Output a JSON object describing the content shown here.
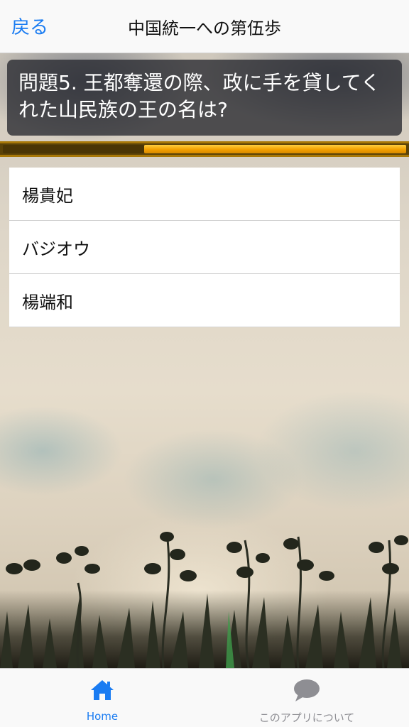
{
  "nav": {
    "back_label": "戻る",
    "title": "中国統一への第伍歩"
  },
  "question": {
    "text": "問題5. 王都奪還の際、政に手を貸してくれた山民族の王の名は?"
  },
  "progress": {
    "fraction": 0.35
  },
  "answers": [
    {
      "label": "楊貴妃"
    },
    {
      "label": "バジオウ"
    },
    {
      "label": "楊端和"
    }
  ],
  "tabbar": {
    "home_label": "Home",
    "home_icon": "house-icon",
    "about_label": "このアプリについて",
    "about_icon": "speech-bubble-icon"
  },
  "colors": {
    "accent": "#1a7cf2",
    "progress_fill": "#f2a000",
    "progress_track": "#5a4208"
  }
}
